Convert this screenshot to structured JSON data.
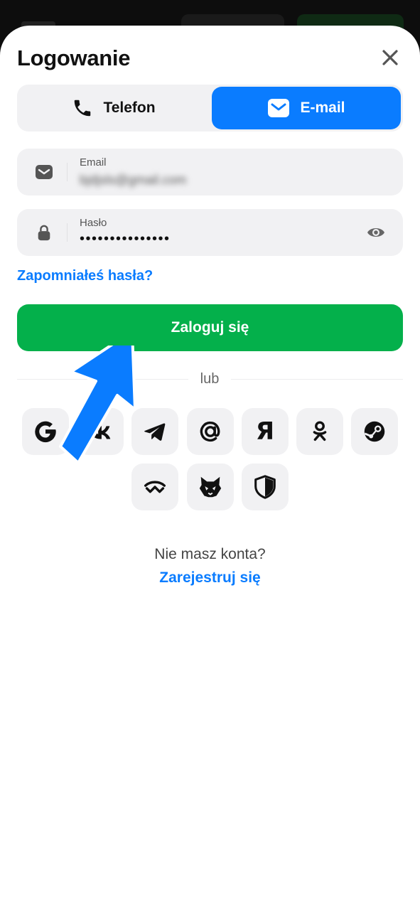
{
  "header": {
    "title": "Logowanie"
  },
  "tabs": {
    "phone_label": "Telefon",
    "email_label": "E-mail",
    "active": "email"
  },
  "email_field": {
    "label": "Email",
    "value": "bjdjsls@gmail.com"
  },
  "password_field": {
    "label": "Hasło",
    "value": "•••••••••••••••"
  },
  "forgot_label": "Zapomniałeś hasła?",
  "login_button": "Zaloguj się",
  "or_label": "lub",
  "social": {
    "icons": [
      "google-icon",
      "vk-icon",
      "telegram-icon",
      "mail-ru-icon",
      "yandex-icon",
      "odnoklassniki-icon",
      "steam-icon",
      "walletconnect-icon",
      "metamask-icon",
      "shield-icon"
    ],
    "yandex_glyph": "Я"
  },
  "footer": {
    "no_account": "Nie masz konta?",
    "register_link": "Zarejestruj się"
  },
  "colors": {
    "accent_blue": "#0a7cff",
    "login_green": "#04b04b",
    "field_bg": "#f1f1f3"
  }
}
